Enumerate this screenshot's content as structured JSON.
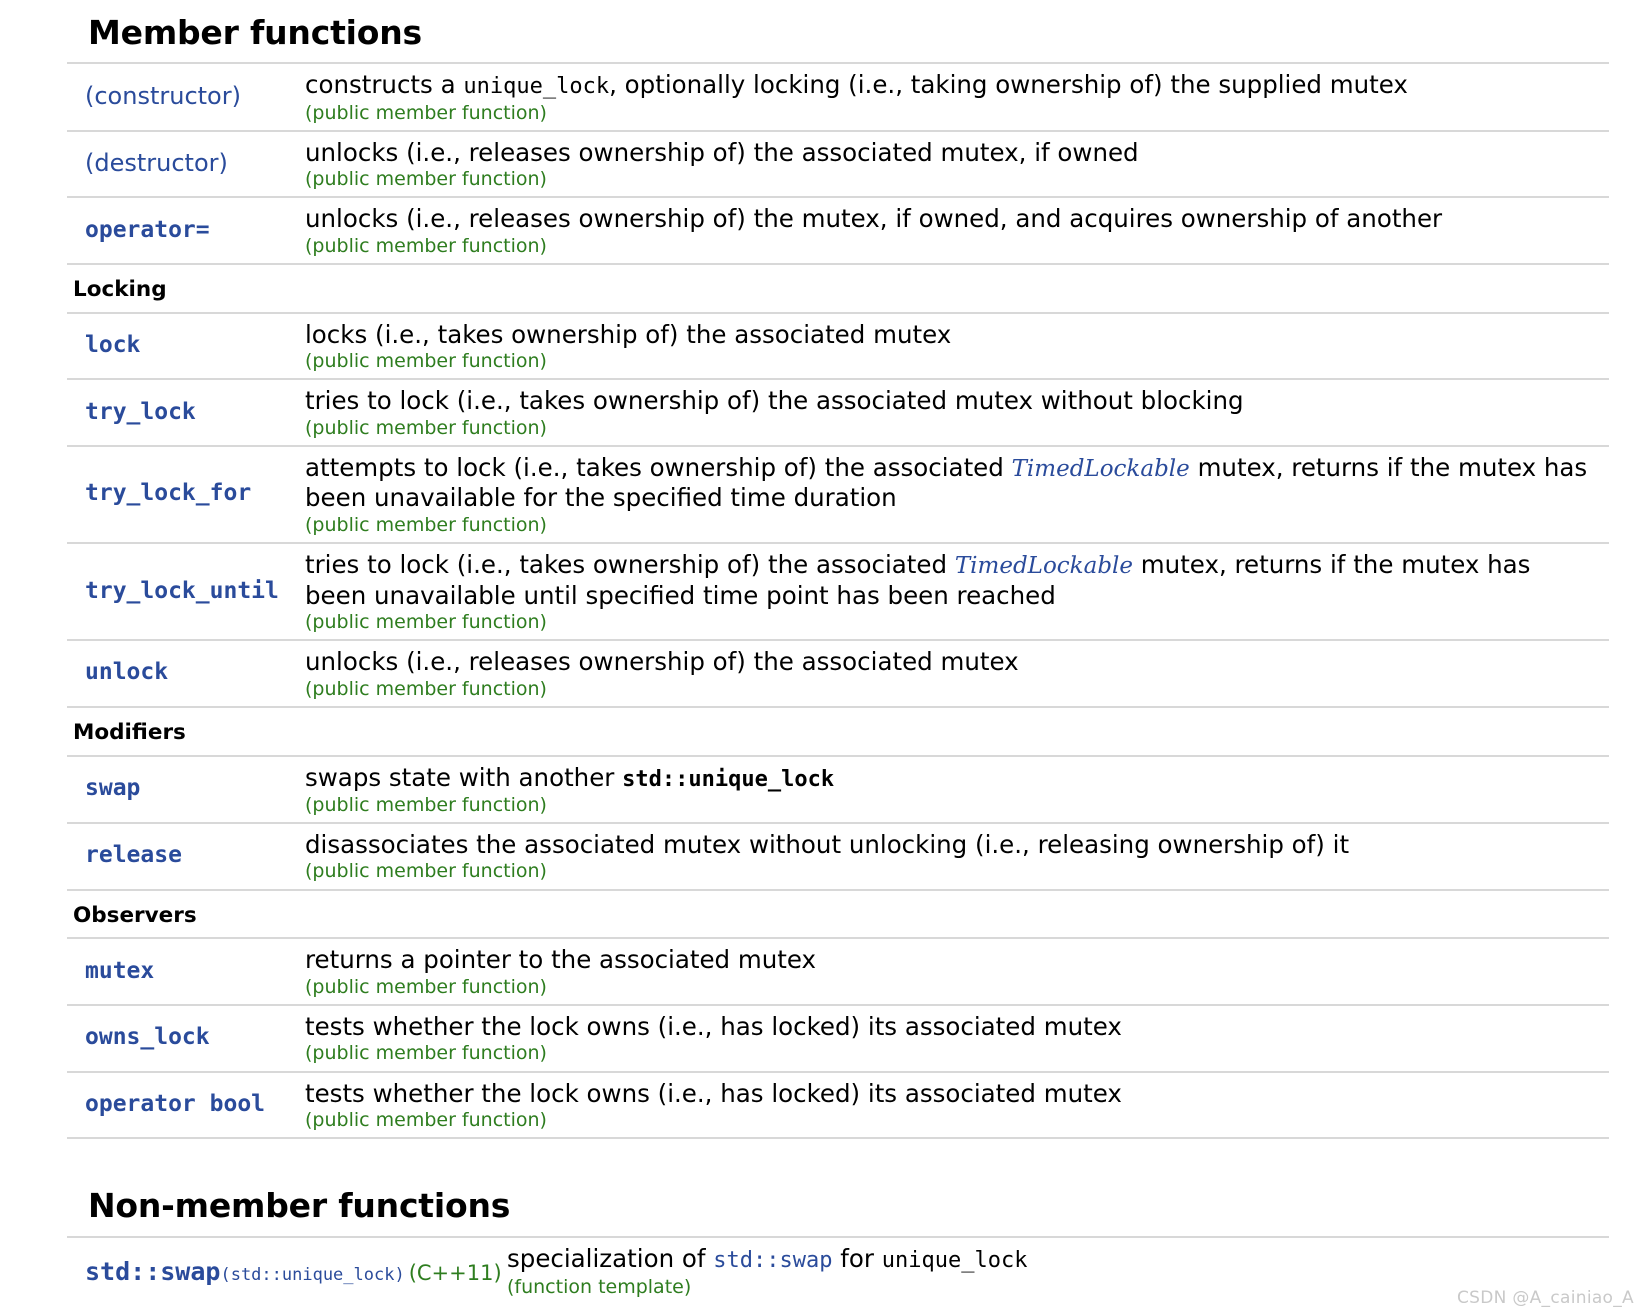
{
  "headings": {
    "member_functions": "Member functions",
    "non_member_functions": "Non-member functions"
  },
  "subheadings": {
    "locking": "Locking",
    "modifiers": "Modifiers",
    "observers": "Observers"
  },
  "labels": {
    "public_member_function": "(public member function)",
    "function_template": "(function template)"
  },
  "colors": {
    "link_blue": "#2a4b9b",
    "meta_green": "#2e7d1f",
    "rule_gray": "#d8d8d8",
    "watermark_gray": "#c9c9c9"
  },
  "member_rows": [
    {
      "name": "(constructor)",
      "name_style": "sans",
      "desc_parts": [
        {
          "t": "constructs a ",
          "s": "plain"
        },
        {
          "t": "unique_lock",
          "s": "mono"
        },
        {
          "t": ", optionally locking (i.e., taking ownership of) the supplied mutex",
          "s": "plain"
        }
      ],
      "meta": "(public member function)"
    },
    {
      "name": "(destructor)",
      "name_style": "sans",
      "desc_parts": [
        {
          "t": "unlocks (i.e., releases ownership of) the associated mutex, if owned",
          "s": "plain"
        }
      ],
      "meta": "(public member function)"
    },
    {
      "name": "operator=",
      "name_style": "mono",
      "desc_parts": [
        {
          "t": "unlocks (i.e., releases ownership of) the mutex, if owned, and acquires ownership of another",
          "s": "plain"
        }
      ],
      "meta": "(public member function)"
    }
  ],
  "locking_rows": [
    {
      "name": "lock",
      "name_style": "mono",
      "desc_parts": [
        {
          "t": "locks (i.e., takes ownership of) the associated mutex",
          "s": "plain"
        }
      ],
      "meta": "(public member function)"
    },
    {
      "name": "try_lock",
      "name_style": "mono",
      "desc_parts": [
        {
          "t": "tries to lock (i.e., takes ownership of) the associated mutex without blocking",
          "s": "plain"
        }
      ],
      "meta": "(public member function)"
    },
    {
      "name": "try_lock_for",
      "name_style": "mono",
      "desc_parts": [
        {
          "t": "attempts to lock (i.e., takes ownership of) the associated ",
          "s": "plain"
        },
        {
          "t": "TimedLockable",
          "s": "named-req"
        },
        {
          "t": " mutex, returns if the mutex has been unavailable for the specified time duration",
          "s": "plain"
        }
      ],
      "meta": "(public member function)"
    },
    {
      "name": "try_lock_until",
      "name_style": "mono",
      "desc_parts": [
        {
          "t": "tries to lock (i.e., takes ownership of) the associated ",
          "s": "plain"
        },
        {
          "t": "TimedLockable",
          "s": "named-req"
        },
        {
          "t": " mutex, returns if the mutex has been unavailable until specified time point has been reached",
          "s": "plain"
        }
      ],
      "meta": "(public member function)"
    },
    {
      "name": "unlock",
      "name_style": "mono",
      "desc_parts": [
        {
          "t": "unlocks (i.e., releases ownership of) the associated mutex",
          "s": "plain"
        }
      ],
      "meta": "(public member function)"
    }
  ],
  "modifiers_rows": [
    {
      "name": "swap",
      "name_style": "mono",
      "desc_parts": [
        {
          "t": "swaps state with another ",
          "s": "plain"
        },
        {
          "t": "std::unique_lock",
          "s": "mono-b"
        }
      ],
      "meta": "(public member function)"
    },
    {
      "name": "release",
      "name_style": "mono",
      "desc_parts": [
        {
          "t": "disassociates the associated mutex without unlocking (i.e., releasing ownership of) it",
          "s": "plain"
        }
      ],
      "meta": "(public member function)"
    }
  ],
  "observers_rows": [
    {
      "name": "mutex",
      "name_style": "mono",
      "desc_parts": [
        {
          "t": "returns a pointer to the associated mutex",
          "s": "plain"
        }
      ],
      "meta": "(public member function)"
    },
    {
      "name": "owns_lock",
      "name_style": "mono",
      "desc_parts": [
        {
          "t": "tests whether the lock owns (i.e., has locked) its associated mutex",
          "s": "plain"
        }
      ],
      "meta": "(public member function)"
    },
    {
      "name": "operator bool",
      "name_style": "mono",
      "desc_parts": [
        {
          "t": "tests whether the lock owns (i.e., has locked) its associated mutex",
          "s": "plain"
        }
      ],
      "meta": "(public member function)"
    }
  ],
  "non_member_rows": [
    {
      "name_main": "std::swap",
      "name_sub": "(std::unique_lock)",
      "name_version": "(C++11)",
      "desc_parts": [
        {
          "t": "specialization of ",
          "s": "plain"
        },
        {
          "t": "std::swap",
          "s": "mono-link-in"
        },
        {
          "t": " for ",
          "s": "plain"
        },
        {
          "t": "unique_lock",
          "s": "mono"
        }
      ],
      "meta": "(function template)"
    }
  ],
  "watermark": "CSDN @A_cainiao_A"
}
